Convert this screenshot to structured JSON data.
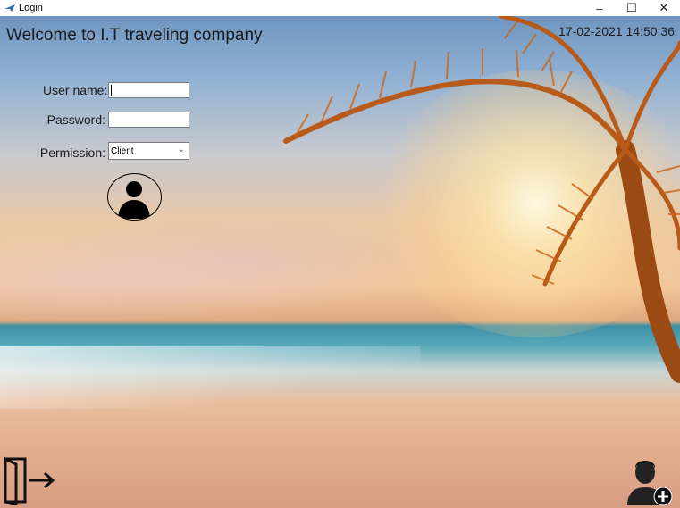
{
  "window": {
    "title": "Login",
    "controls": {
      "minimize": "–",
      "maximize": "☐",
      "close": "✕"
    }
  },
  "header": {
    "welcome": "Welcome to I.T traveling company",
    "datetime": "17-02-2021 14:50:36"
  },
  "form": {
    "username_label": "User name:",
    "username_value": "",
    "password_label": "Password:",
    "password_value": "",
    "permission_label": "Permission:",
    "permission_value": "Client"
  },
  "icons": {
    "app": "plane-icon",
    "login": "user-avatar-icon",
    "exit": "exit-door-icon",
    "register": "add-user-icon"
  }
}
